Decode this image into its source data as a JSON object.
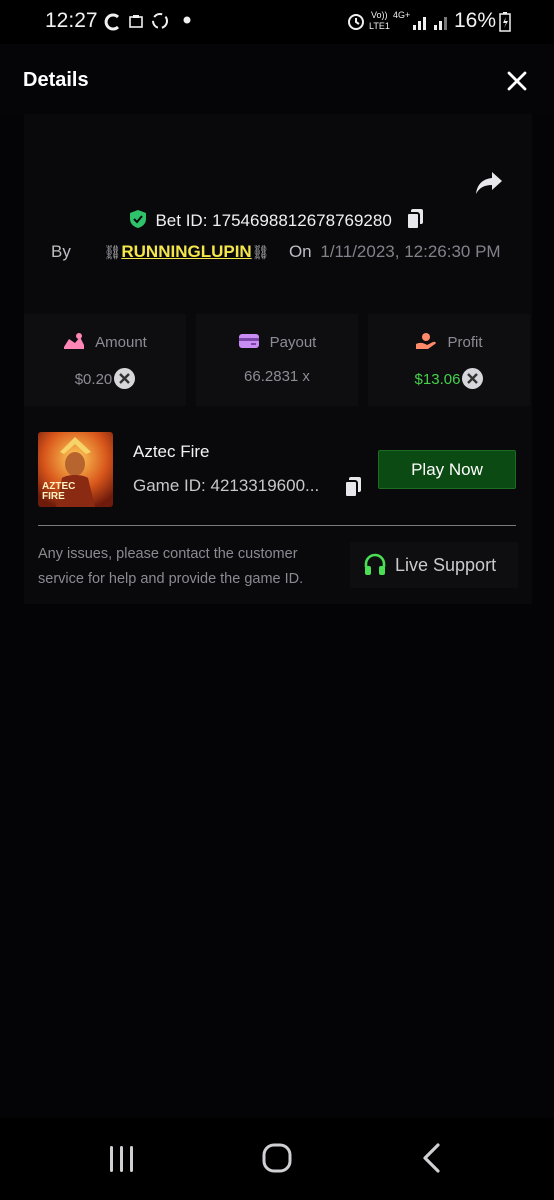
{
  "status_bar": {
    "time": "12:27",
    "battery": "16%",
    "network_volte": "Vo))",
    "network_lte": "LTE1",
    "network_4g": "4G+",
    "icons": [
      "c-icon",
      "shop-icon",
      "sync-icon",
      "dot-icon",
      "alarm-icon",
      "signal-icon",
      "battery-icon"
    ]
  },
  "header": {
    "title": "Details"
  },
  "bet": {
    "label": "Bet ID:",
    "id": "1754698812678769280",
    "by_label": "By",
    "user": "RUNNINGLUPIN",
    "chain_left": "⛓",
    "chain_right": "⛓",
    "on_label": "On",
    "datetime": "1/11/2023, 12:26:30 PM"
  },
  "stats": {
    "amount": {
      "label": "Amount",
      "value": "$0.20"
    },
    "payout": {
      "label": "Payout",
      "value": "66.2831 x"
    },
    "profit": {
      "label": "Profit",
      "value": "$13.06"
    }
  },
  "game": {
    "name": "Aztec Fire",
    "id_label": "Game ID:",
    "id_value": "4213319600...",
    "play_label": "Play Now",
    "thumb_text_line1": "AZTEC",
    "thumb_text_line2": "FIRE"
  },
  "support": {
    "help_text": "Any issues, please contact the customer service for help and provide the game ID.",
    "button_label": "Live Support"
  },
  "colors": {
    "background": "#040406",
    "accent_green": "#0b4a12",
    "profit_green": "#45d14a",
    "username_yellow": "#f4e64a",
    "shield_green": "#2fc26a"
  }
}
